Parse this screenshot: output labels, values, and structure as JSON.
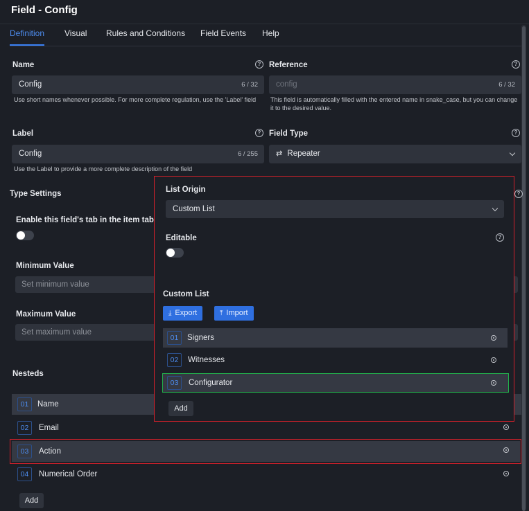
{
  "title": "Field - Config",
  "tabs": [
    "Definition",
    "Visual",
    "Rules and Conditions",
    "Field Events",
    "Help"
  ],
  "name": {
    "label": "Name",
    "value": "Config",
    "counter": "6 / 32",
    "hint": "Use short names whenever possible. For more complete regulation, use the 'Label' field"
  },
  "reference": {
    "label": "Reference",
    "placeholder": "config",
    "counter": "6 / 32",
    "hint": "This field is automatically filled with the entered name in snake_case, but you can change it to the desired value."
  },
  "label_field": {
    "label": "Label",
    "value": "Config",
    "counter": "6 / 255",
    "hint": "Use the Label to provide a more complete description of the field"
  },
  "field_type": {
    "label": "Field Type",
    "value": "Repeater",
    "icon": "repeat-icon"
  },
  "type_settings": {
    "title": "Type Settings",
    "enable_tab_label": "Enable this field's tab in the item table",
    "enable_tab_on": false,
    "min_label": "Minimum Value",
    "min_placeholder": "Set minimum value",
    "max_label": "Maximum Value",
    "max_placeholder": "Set maximum value"
  },
  "nesteds": {
    "title": "Nesteds",
    "items": [
      {
        "num": "01",
        "label": "Name"
      },
      {
        "num": "02",
        "label": "Email"
      },
      {
        "num": "03",
        "label": "Action"
      },
      {
        "num": "04",
        "label": "Numerical Order"
      }
    ],
    "add_label": "Add"
  },
  "popup": {
    "list_origin_label": "List Origin",
    "list_origin_value": "Custom List",
    "editable_label": "Editable",
    "editable_on": false,
    "custom_list_label": "Custom List",
    "export_label": "Export",
    "import_label": "Import",
    "items": [
      {
        "num": "01",
        "label": "Signers"
      },
      {
        "num": "02",
        "label": "Witnesses"
      },
      {
        "num": "03",
        "label": "Configurator"
      }
    ],
    "add_label": "Add"
  },
  "colors": {
    "accent": "#3b82f6",
    "highlight_red": "#d0202a",
    "highlight_green": "#22b14c",
    "bg": "#1c1f26"
  }
}
